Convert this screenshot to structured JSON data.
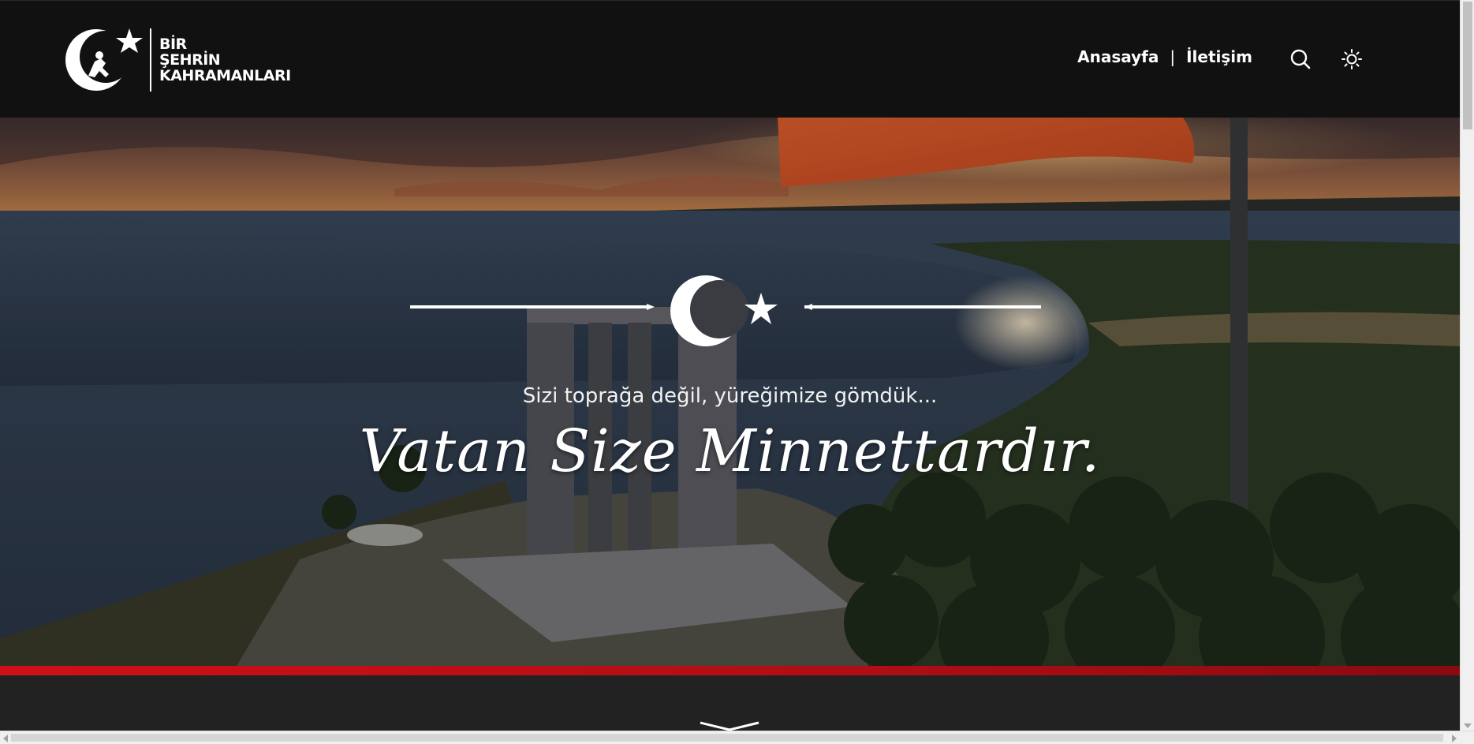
{
  "logo": {
    "lines": [
      "BİR",
      "ŞEHRİN",
      "KAHRAMANLARI"
    ],
    "icon": "crescent-star-soldier-icon"
  },
  "nav": {
    "home": "Anasayfa",
    "separator": "|",
    "contact": "İletişim"
  },
  "icons": {
    "search": "search-icon",
    "theme": "sun-icon"
  },
  "hero": {
    "tagline": "Sizi toprağa değil, yüreğimize gömdük...",
    "headline": "Vatan Size Minnettardır.",
    "emblem": "crescent-star-icon"
  },
  "colors": {
    "topbar": "#111112",
    "accent_red": "#d01018",
    "lower_bg": "#222223",
    "text": "#ffffff"
  }
}
